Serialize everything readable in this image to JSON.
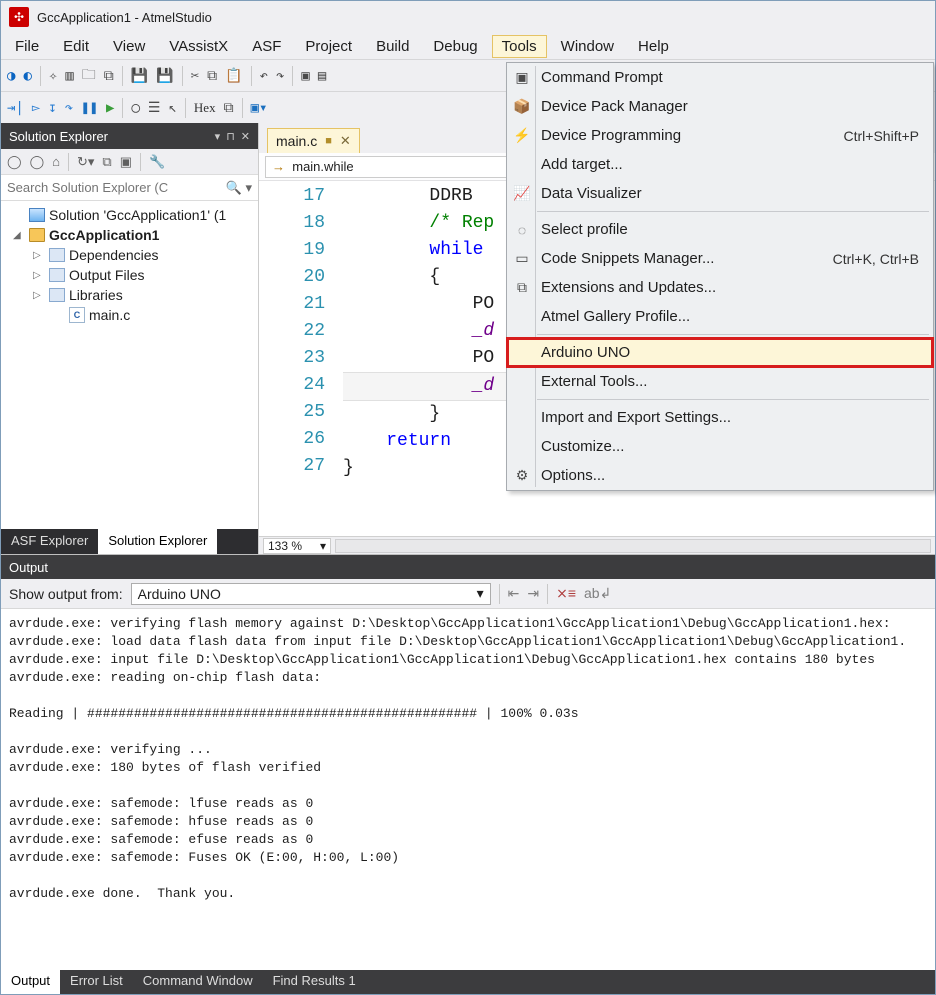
{
  "window": {
    "title": "GccApplication1 - AtmelStudio"
  },
  "menubar": [
    "File",
    "Edit",
    "View",
    "VAssistX",
    "ASF",
    "Project",
    "Build",
    "Debug",
    "Tools",
    "Window",
    "Help"
  ],
  "menubar_open_index": 8,
  "toolbar1": {
    "hex_label": "Hex"
  },
  "tools_menu": {
    "items": [
      {
        "icon": "term",
        "label": "Command Prompt",
        "shortcut": ""
      },
      {
        "icon": "pack",
        "label": "Device Pack Manager",
        "shortcut": ""
      },
      {
        "icon": "prog",
        "label": "Device Programming",
        "shortcut": "Ctrl+Shift+P"
      },
      {
        "icon": "",
        "label": "Add target...",
        "shortcut": ""
      },
      {
        "icon": "viz",
        "label": "Data Visualizer",
        "shortcut": ""
      },
      {
        "sep": true
      },
      {
        "icon": "prof",
        "label": "Select profile",
        "shortcut": ""
      },
      {
        "icon": "snip",
        "label": "Code Snippets Manager...",
        "shortcut": "Ctrl+K, Ctrl+B"
      },
      {
        "icon": "ext",
        "label": "Extensions and Updates...",
        "shortcut": ""
      },
      {
        "icon": "",
        "label": "Atmel Gallery Profile...",
        "shortcut": ""
      },
      {
        "sep": true
      },
      {
        "icon": "",
        "label": "Arduino UNO",
        "shortcut": "",
        "highlight": true
      },
      {
        "icon": "",
        "label": "External Tools...",
        "shortcut": ""
      },
      {
        "sep": true
      },
      {
        "icon": "",
        "label": "Import and Export Settings...",
        "shortcut": ""
      },
      {
        "icon": "",
        "label": "Customize...",
        "shortcut": ""
      },
      {
        "icon": "gear",
        "label": "Options...",
        "shortcut": ""
      }
    ]
  },
  "solution_explorer": {
    "title": "Solution Explorer",
    "search_placeholder": "Search Solution Explorer (C",
    "root": "Solution 'GccApplication1' (1",
    "project": "GccApplication1",
    "nodes": [
      "Dependencies",
      "Output Files",
      "Libraries"
    ],
    "file": "main.c",
    "tabs": [
      "ASF Explorer",
      "Solution Explorer"
    ],
    "active_tab": 1
  },
  "editor": {
    "tab": "main.c",
    "combo": "main.while",
    "zoom": "133 %",
    "first_line": 17,
    "lines": [
      {
        "raw": "DDRB "
      },
      {
        "raw": "/* Rep",
        "cls": "cm"
      },
      {
        "raw": "while ",
        "cls": "kw"
      },
      {
        "raw": "{"
      },
      {
        "raw": "    PO"
      },
      {
        "raw": "    _d",
        "mac": true
      },
      {
        "raw": "    PO"
      },
      {
        "raw": "    _d",
        "mac": true,
        "current": true
      },
      {
        "raw": "}"
      },
      {
        "raw": "return",
        "cls": "kw",
        "outdent": true
      },
      {
        "raw": "}",
        "far": true
      }
    ]
  },
  "output": {
    "title": "Output",
    "show_from_label": "Show output from:",
    "source": "Arduino UNO",
    "text": "avrdude.exe: verifying flash memory against D:\\Desktop\\GccApplication1\\GccApplication1\\Debug\\GccApplication1.hex:\navrdude.exe: load data flash data from input file D:\\Desktop\\GccApplication1\\GccApplication1\\Debug\\GccApplication1.\navrdude.exe: input file D:\\Desktop\\GccApplication1\\GccApplication1\\Debug\\GccApplication1.hex contains 180 bytes\navrdude.exe: reading on-chip flash data:\n\nReading | ################################################## | 100% 0.03s\n\navrdude.exe: verifying ...\navrdude.exe: 180 bytes of flash verified\n\navrdude.exe: safemode: lfuse reads as 0\navrdude.exe: safemode: hfuse reads as 0\navrdude.exe: safemode: efuse reads as 0\navrdude.exe: safemode: Fuses OK (E:00, H:00, L:00)\n\navrdude.exe done.  Thank you.\n",
    "tabs": [
      "Output",
      "Error List",
      "Command Window",
      "Find Results 1"
    ],
    "active_tab": 0
  }
}
